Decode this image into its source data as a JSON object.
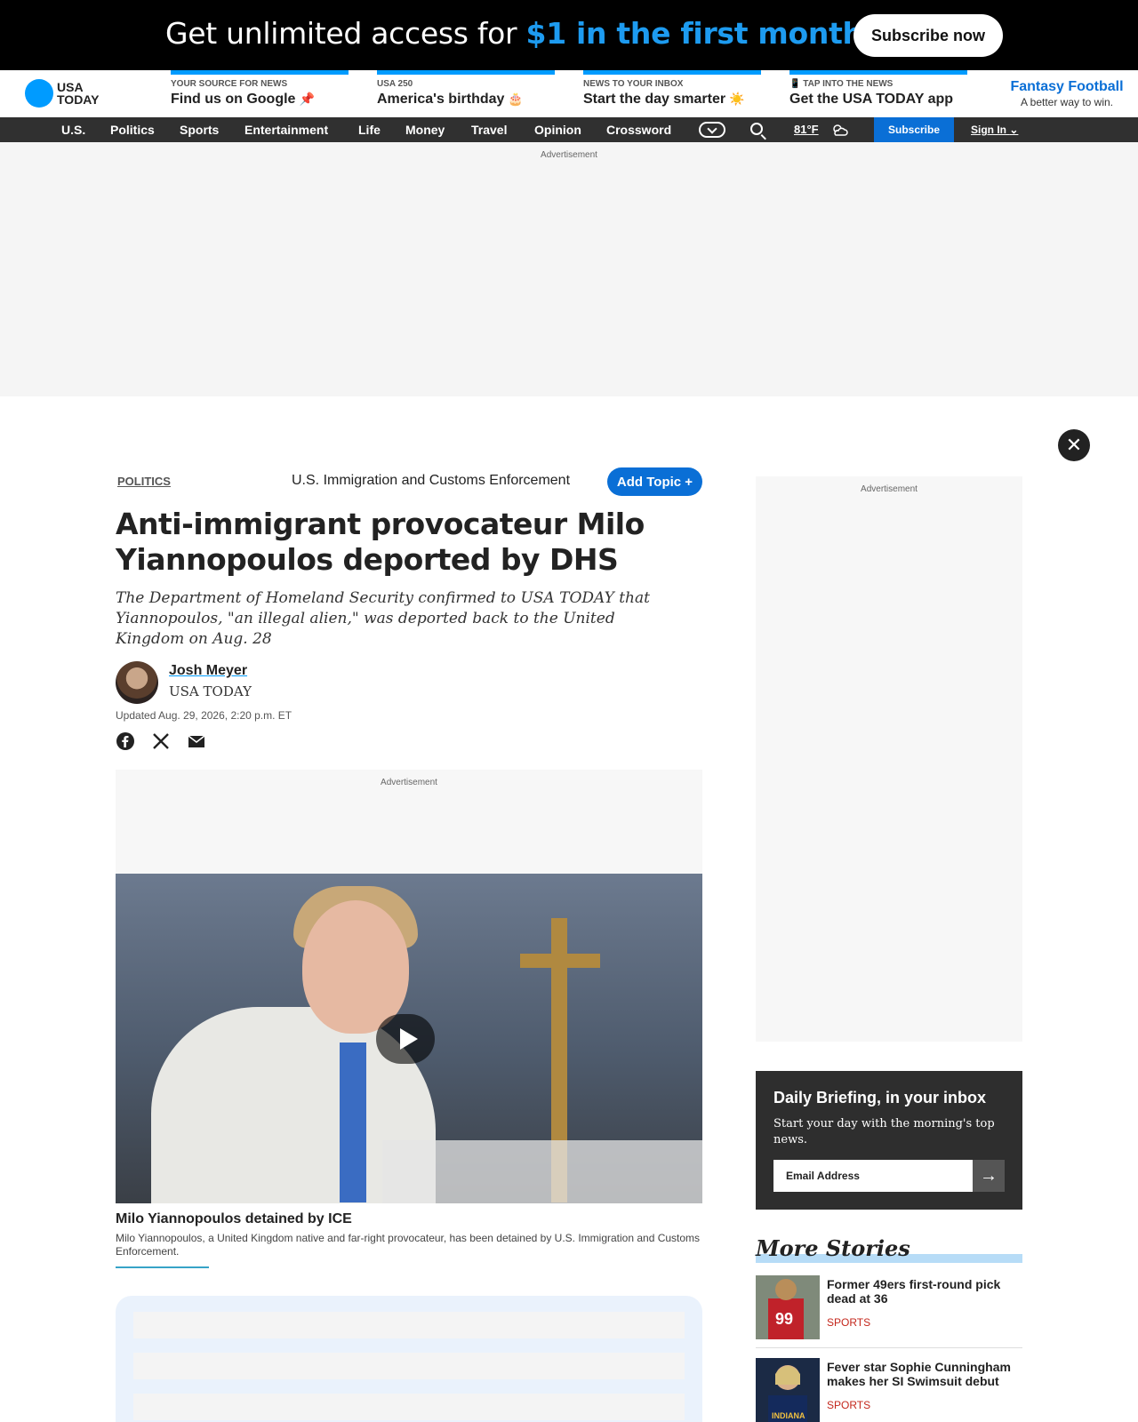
{
  "promo": {
    "text_prefix": "Get unlimited access for ",
    "text_highlight": "$1 in the first month.",
    "cta": "Subscribe now"
  },
  "masthead": {
    "logo_line1": "USA",
    "logo_line2": "TODAY",
    "cards": [
      {
        "kicker": "YOUR SOURCE FOR NEWS",
        "title": "Find us on Google",
        "emoji": "📌"
      },
      {
        "kicker": "USA 250",
        "title": "America's birthday",
        "emoji": "🎂"
      },
      {
        "kicker": "NEWS TO YOUR INBOX",
        "title": "Start the day smarter",
        "emoji": "☀️"
      },
      {
        "kicker": "TAP INTO THE NEWS",
        "title": "Get the USA TODAY app",
        "emoji": "📱"
      }
    ],
    "fantasy_title": "Fantasy Football",
    "fantasy_sub": "A better way to win."
  },
  "nav": {
    "items": [
      "U.S.",
      "Politics",
      "Sports",
      "Entertainment",
      "Life",
      "Money",
      "Travel",
      "Opinion",
      "Crossword"
    ],
    "weather": "81°F",
    "subscribe": "Subscribe",
    "signin": "Sign In"
  },
  "ads": {
    "label": "Advertisement"
  },
  "article": {
    "section": "POLITICS",
    "topic": "U.S. Immigration and Customs Enforcement",
    "add_topic": "Add Topic +",
    "headline": "Anti-immigrant provocateur Milo Yiannopoulos deported by DHS",
    "dek": "The Department of Homeland Security confirmed to USA TODAY that Yiannopoulos, \"an illegal alien,\" was deported back to the United Kingdom on Aug. 28",
    "author": "Josh Meyer",
    "author_org": "USA TODAY",
    "updated": "Updated Aug. 29, 2026, 2:20 p.m. ET",
    "video_title": "Milo Yiannopoulos detained by ICE",
    "video_caption": "Milo Yiannopoulos, a United Kingdom native and far-right provocateur, has been detained by U.S. Immigration and Customs Enforcement."
  },
  "newsletter": {
    "title": "Daily Briefing, in your inbox",
    "subtitle": "Start your day with the morning's top news.",
    "placeholder": "Email Address"
  },
  "more_stories": {
    "title": "More Stories",
    "items": [
      {
        "title": "Former 49ers first-round pick dead at 36",
        "category": "SPORTS"
      },
      {
        "title": "Fever star Sophie Cunningham makes her SI Swimsuit debut",
        "category": "SPORTS"
      }
    ]
  },
  "colors": {
    "brand_blue": "#009bff",
    "link_blue": "#0a6fd6",
    "promo_highlight": "#1d9bf0",
    "category_red": "#c4271c"
  }
}
